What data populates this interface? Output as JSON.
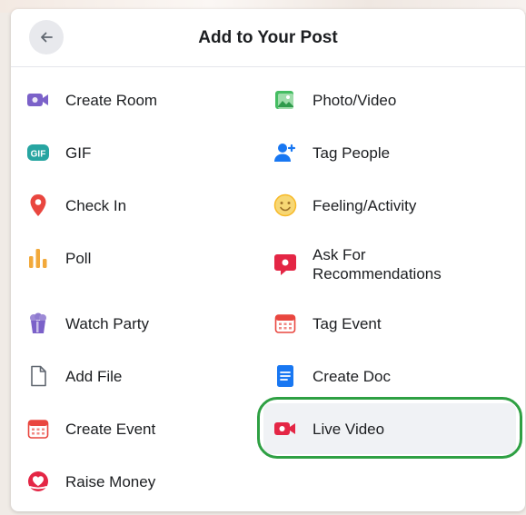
{
  "header": {
    "title": "Add to Your Post"
  },
  "left_items": [
    {
      "label": "Create Room",
      "icon": "video-camera-icon"
    },
    {
      "label": "GIF",
      "icon": "gif-icon"
    },
    {
      "label": "Check In",
      "icon": "location-pin-icon"
    },
    {
      "label": "Poll",
      "icon": "poll-icon"
    },
    {
      "label": "Watch Party",
      "icon": "popcorn-icon"
    },
    {
      "label": "Add File",
      "icon": "file-icon"
    },
    {
      "label": "Create Event",
      "icon": "calendar-icon"
    },
    {
      "label": "Raise Money",
      "icon": "heart-hands-icon"
    }
  ],
  "right_items": [
    {
      "label": "Photo/Video",
      "icon": "photo-icon"
    },
    {
      "label": "Tag People",
      "icon": "tag-people-icon"
    },
    {
      "label": "Feeling/Activity",
      "icon": "smiley-icon"
    },
    {
      "label": "Ask For\nRecommendations",
      "icon": "recommendation-icon"
    },
    {
      "label": "Tag Event",
      "icon": "calendar-icon"
    },
    {
      "label": "Create Doc",
      "icon": "document-icon"
    },
    {
      "label": "Live Video",
      "icon": "live-video-icon"
    }
  ],
  "colors": {
    "purple": "#7b61c9",
    "teal": "#27a5a1",
    "red_pin": "#e9463f",
    "orange_poll": "#f2a93b",
    "green_photo": "#45bd62",
    "blue_people": "#1877f2",
    "yellow_smiley": "#f7b928",
    "red_live": "#e42645",
    "highlight_ring": "#2ea043"
  }
}
